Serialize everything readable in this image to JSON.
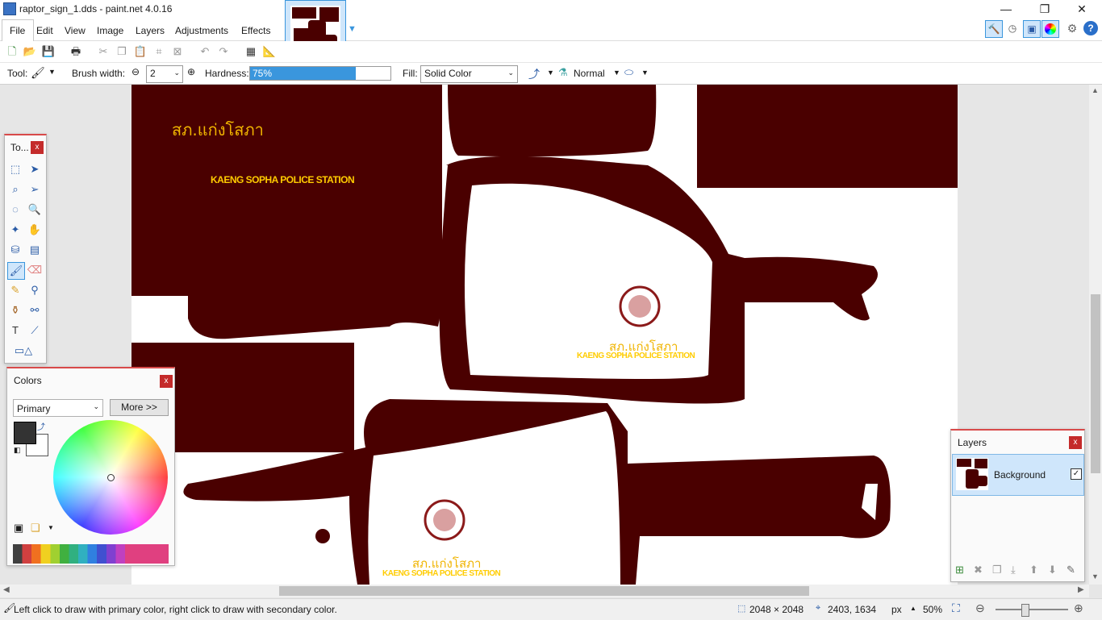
{
  "window": {
    "title": "raptor_sign_1.dds - paint.net 4.0.16"
  },
  "menu": [
    "File",
    "Edit",
    "View",
    "Image",
    "Layers",
    "Adjustments",
    "Effects"
  ],
  "options": {
    "tool_label": "Tool:",
    "brush_width_label": "Brush width:",
    "brush_width_value": "2",
    "hardness_label": "Hardness:",
    "hardness_value": "75%",
    "hardness_fraction": 0.75,
    "fill_label": "Fill:",
    "fill_value": "Solid Color",
    "blend_mode": "Normal"
  },
  "tools_panel": {
    "title": "To...",
    "close": "x"
  },
  "colors_panel": {
    "title": "Colors",
    "close": "x",
    "mode": "Primary",
    "more_button": "More >>"
  },
  "layers_panel": {
    "title": "Layers",
    "close": "x",
    "layers": [
      {
        "name": "Background",
        "visible": true
      }
    ]
  },
  "canvas_text": {
    "thai_top": "สภ.แก่งโสภา",
    "english_top": "KAENG SOPHA POLICE STATION",
    "thai_mid": "สภ.แก่งโสภา",
    "english_mid": "KAENG SOPHA POLICE STATION",
    "thai_bottom": "สภ.แก่งโสภา",
    "english_bottom": "KAENG SOPHA POLICE STATION"
  },
  "status": {
    "hint": "Left click to draw with primary color, right click to draw with secondary color.",
    "image_size": "2048 × 2048",
    "cursor_pos": "2403, 1634",
    "units": "px",
    "zoom": "50%"
  },
  "colors": {
    "maroon": "#4a0000",
    "accent": "#d84a4a",
    "selection": "#3a96dd",
    "text_yellow": "#ffcc00"
  }
}
